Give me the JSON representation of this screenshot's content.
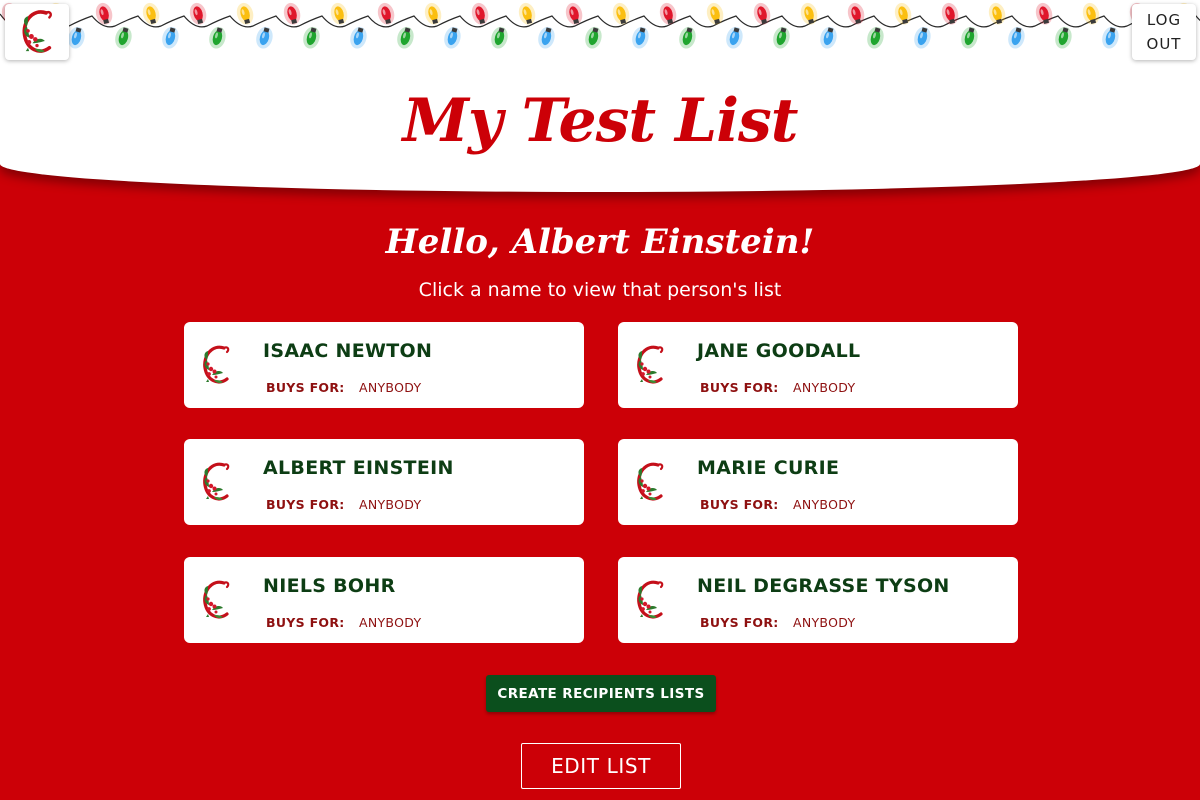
{
  "header": {
    "title": "My Test List",
    "logout_line1": "LOG",
    "logout_line2": "OUT",
    "logo_icon": "wreath-c-icon",
    "light_colors": [
      "#e0162b",
      "#1fa52e",
      "#fbbf10",
      "#3aa3ef"
    ]
  },
  "main": {
    "greeting": "Hello, Albert Einstein!",
    "subtitle": "Click a name to view that person's list",
    "people": [
      {
        "name": "ISAAC NEWTON",
        "buys_label": "BUYS FOR:",
        "buys_value": "ANYBODY"
      },
      {
        "name": "JANE GOODALL",
        "buys_label": "BUYS FOR:",
        "buys_value": "ANYBODY"
      },
      {
        "name": "ALBERT EINSTEIN",
        "buys_label": "BUYS FOR:",
        "buys_value": "ANYBODY"
      },
      {
        "name": "MARIE CURIE",
        "buys_label": "BUYS FOR:",
        "buys_value": "ANYBODY"
      },
      {
        "name": "NIELS BOHR",
        "buys_label": "BUYS FOR:",
        "buys_value": "ANYBODY"
      },
      {
        "name": "NEIL DEGRASSE TYSON",
        "buys_label": "BUYS FOR:",
        "buys_value": "ANYBODY"
      }
    ],
    "create_button": "CREATE RECIPIENTS LISTS",
    "edit_button": "EDIT LIST"
  },
  "colors": {
    "brand_red": "#cc0007",
    "brand_green": "#0b4f1d",
    "name_green": "#0d3d14",
    "label_red": "#8e1010"
  }
}
